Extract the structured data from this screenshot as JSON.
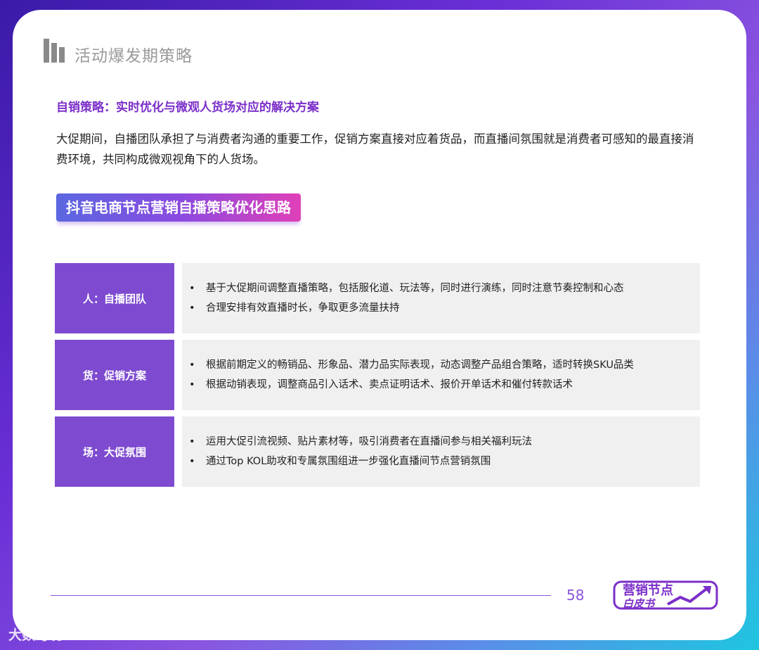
{
  "header": {
    "title": "活动爆发期策略"
  },
  "subtitle": "自销策略：实时优化与微观人货场对应的解决方案",
  "paragraph": "大促期间，自播团队承担了与消费者沟通的重要工作，促销方案直接对应着货品，而直播间氛围就是消费者可感知的最直接消费环境，共同构成微观视角下的人货场。",
  "banner": "抖音电商节点营销自播策略优化思路",
  "rows": [
    {
      "label": "人：自播团队",
      "bullets": [
        "基于大促期间调整直播策略，包括服化道、玩法等，同时进行演练，同时注意节奏控制和心态",
        "合理安排有效直播时长，争取更多流量扶持"
      ]
    },
    {
      "label": "货：促销方案",
      "bullets": [
        "根据前期定义的畅销品、形象品、潜力品实际表现，动态调整产品组合策略，适时转换SKU品类",
        "根据动销表现，调整商品引入话术、卖点证明话术、报价开单话术和催付转款话术"
      ]
    },
    {
      "label": "场：大促氛围",
      "bullets": [
        "运用大促引流视频、贴片素材等，吸引消费者在直播间参与相关福利玩法",
        "通过Top KOL助攻和专属氛围组进一步强化直播间节点营销氛围"
      ]
    }
  ],
  "bullet_symbol": "•",
  "footer": {
    "page_number": "58",
    "brand_line1": "营销节点",
    "brand_line2": "白皮书"
  },
  "watermark": "大数跨境",
  "colors": {
    "accent": "#7e4bd0",
    "subtitle": "#7b2fc9",
    "row_bg": "#f0f0f0"
  }
}
